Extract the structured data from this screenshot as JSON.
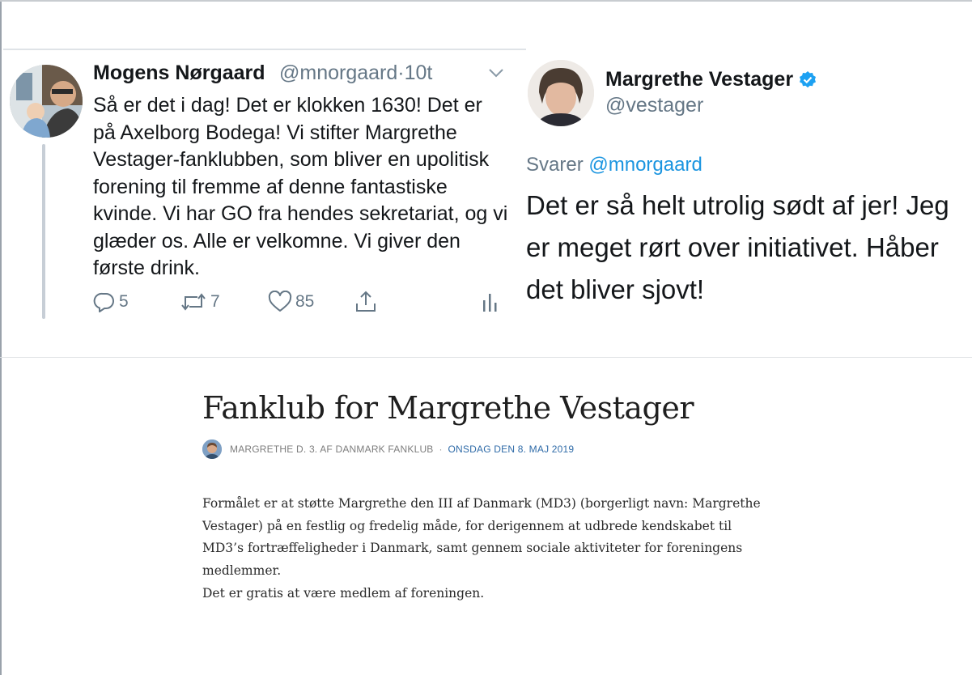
{
  "tweet1": {
    "author_name": "Mogens Nørgaard",
    "handle": "@mnorgaard",
    "separator": "·",
    "time": "10t",
    "text": "Så er det i dag! Det er klokken 1630! Det er på Axelborg Bodega! Vi stifter Margrethe Vestager-fanklubben, som bliver en upolitisk forening til fremme af denne fantastiske kvinde. Vi har GO fra hendes sekretariat, og vi glæder os. Alle er velkomne. Vi giver den første drink.",
    "reply_count": "5",
    "retweet_count": "7",
    "like_count": "85"
  },
  "tweet2": {
    "author_name": "Margrethe Vestager",
    "handle": "@vestager",
    "reply_prefix": "Svarer",
    "reply_to": "@mnorgaard",
    "text": "Det er så helt utrolig sødt af jer! Jeg er meget rørt over initiativet. Håber det bliver sjovt!"
  },
  "article": {
    "title": "Fanklub for Margrethe Vestager",
    "author": "MARGRETHE D. 3. AF DANMARK FANKLUB",
    "meta_separator": "·",
    "date": "ONSDAG DEN 8. MAJ 2019",
    "paragraphs": [
      "Formålet er at støtte Margrethe den III af Danmark (MD3) (borgerligt navn: Margrethe Vestager) på en festlig og fredelig måde, for derigennem at udbrede kendskabet til MD3’s fortræffeligheder i Danmark, samt gennem sociale aktiviteter for foreningens medlemmer.",
      "Det er gratis at være medlem af foreningen."
    ]
  },
  "icons": [
    "chevron-down-icon",
    "reply-icon",
    "retweet-icon",
    "like-icon",
    "share-icon",
    "analytics-icon",
    "verified-badge-icon"
  ],
  "colors": {
    "twitter_blue": "#1b95e0",
    "secondary_text": "#657786",
    "link_date": "#2f6ba8"
  }
}
